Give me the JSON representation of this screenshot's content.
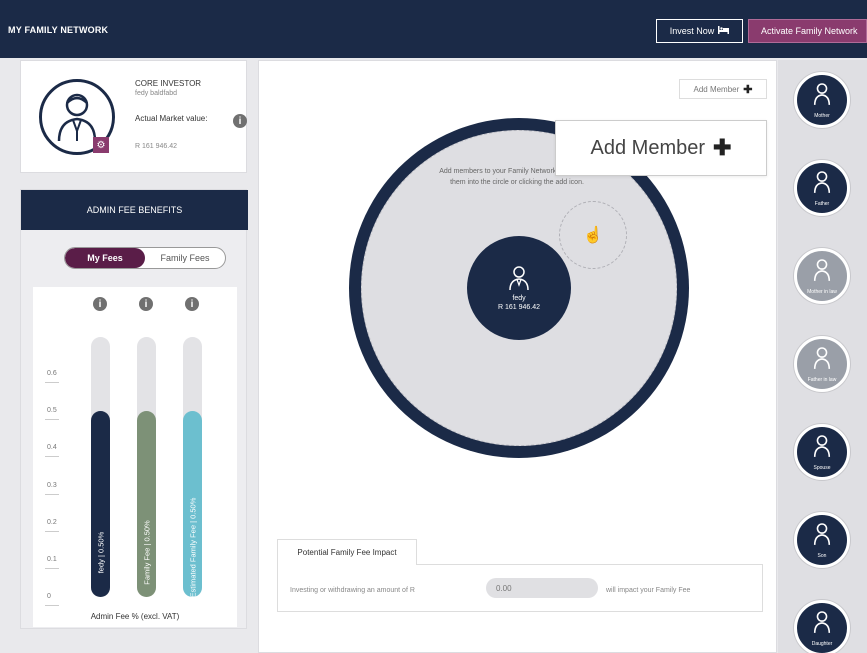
{
  "header": {
    "title": "MY FAMILY NETWORK",
    "invest_label": "Invest Now",
    "activate_label": "Activate Family Network"
  },
  "profile": {
    "role": "CORE INVESTOR",
    "username": "fedy baldfabd",
    "market_value_label": "Actual Market value:",
    "market_value": "R 161 946.42"
  },
  "fees": {
    "title": "ADMIN FEE BENEFITS",
    "tabs": [
      "My Fees",
      "Family Fees"
    ],
    "active_tab": "My Fees",
    "caption": "Admin Fee % (excl. VAT)"
  },
  "chart_data": {
    "type": "bar",
    "categories": [
      "fedy",
      "Family Fee",
      "Estimated Family Fee"
    ],
    "bar_labels": [
      "fedy | 0.50%",
      "Family Fee | 0.50%",
      "Estimated Family Fee | 0.50%"
    ],
    "values": [
      0.5,
      0.5,
      0.5
    ],
    "ylim": [
      0,
      0.7
    ],
    "yticks": [
      "0",
      "0.1",
      "0.2",
      "0.3",
      "0.4",
      "0.5",
      "0.6"
    ],
    "colors": [
      "#1b2a47",
      "#7d9177",
      "#6cbfcf"
    ],
    "ylabel": "Admin Fee % (excl. VAT)"
  },
  "network": {
    "add_member_label": "Add Member",
    "drop_hint": "Add members to your Family Network by dragging them into the circle or clicking the add icon.",
    "center_name": "fedy",
    "center_value": "R 161 946.42"
  },
  "impact": {
    "tab_label": "Potential Family Fee Impact",
    "prefix": "Investing or withdrawing an amount of R",
    "amount": "0.00",
    "suffix": "will impact your Family Fee"
  },
  "callout": {
    "label": "Add Member"
  },
  "relatives": [
    {
      "label": "Mother",
      "faded": false
    },
    {
      "label": "Father",
      "faded": false
    },
    {
      "label": "Mother in law",
      "faded": true
    },
    {
      "label": "Father in law",
      "faded": true
    },
    {
      "label": "Spouse",
      "faded": false
    },
    {
      "label": "Son",
      "faded": false
    },
    {
      "label": "Daughter",
      "faded": false
    }
  ],
  "colors": {
    "navy": "#1b2a47",
    "plum": "#8a3b6e",
    "deep_plum": "#5a1d48"
  }
}
